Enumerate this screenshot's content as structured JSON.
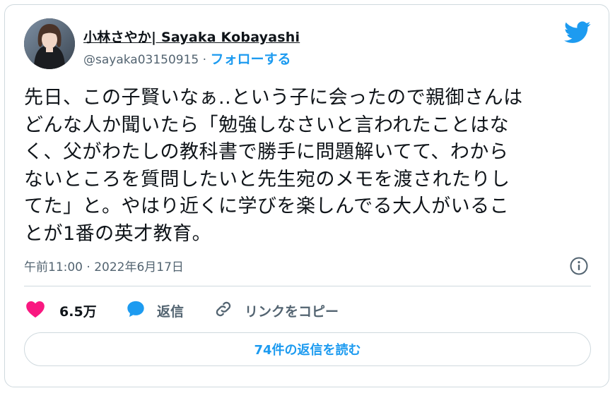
{
  "tweet": {
    "author_name": "小林さやか| Sayaka Kobayashi",
    "handle": "@sayaka03150915",
    "separator": " · ",
    "follow_label": "フォローする",
    "body_lines": [
      "先日、この子賢いなぁ..という子に会ったので親御さんは",
      "どんな人か聞いたら「勉強しなさいと言われたことはな",
      "く、父がわたしの教科書で勝手に問題解いてて、わから",
      "ないところを質問したいと先生宛のメモを渡されたりし",
      "てた」と。やはり近くに学びを楽しんでる大人がいるこ",
      "とが1番の英才教育。"
    ],
    "timestamp": "午前11:00 · 2022年6月17日"
  },
  "actions": {
    "like_count": "6.5万",
    "reply_label": "返信",
    "copy_link_label": "リンクをコピー"
  },
  "read_replies_label": "74件の返信を読む",
  "colors": {
    "accent": "#1d9bf0",
    "like": "#f91880",
    "secondary_text": "#536471",
    "border": "#cfd9de"
  },
  "icons": [
    "twitter-bird-icon",
    "info-icon",
    "heart-icon",
    "reply-bubble-icon",
    "link-icon"
  ]
}
